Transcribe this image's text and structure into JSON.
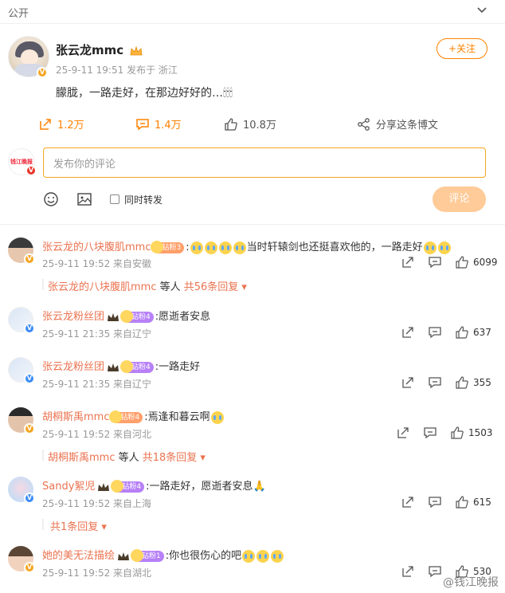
{
  "visibility": {
    "label": "公开"
  },
  "post": {
    "author": "张云龙mmc",
    "time": "25-9-11 19:51",
    "location": "发布于 浙江",
    "follow_label": "+关注",
    "text": "朦胧，一路走好，在那边好好的…🕯🕯🕯",
    "reposts": "1.2万",
    "comments": "1.4万",
    "likes": "10.8万",
    "share_label": "分享这条博文"
  },
  "composer": {
    "placeholder": "发布你的评论",
    "repost_label": "同时转发",
    "submit_label": "评论",
    "self_avatar_text": "钱江晚报"
  },
  "comments": [
    {
      "name": "张云龙的八块腹肌mmc",
      "badge": "钻粉3",
      "text": "当时轩辕剑也还挺喜欢他的，一路走好",
      "time": "25-9-11 19:52 来自安徽",
      "likes": "6099",
      "reply_user": "张云龙的八块腹肌mmc",
      "reply_mid": " 等人 ",
      "reply_count": "共56条回复"
    },
    {
      "name": "张云龙粉丝团",
      "badge": "钻粉4",
      "text": ":愿逝者安息",
      "time": "25-9-11 21:35 来自辽宁",
      "likes": "637"
    },
    {
      "name": "张云龙粉丝团",
      "badge": "钻粉4",
      "text": ":一路走好",
      "time": "25-9-11 21:35 来自辽宁",
      "likes": "355"
    },
    {
      "name": "胡桐斯禹mmc",
      "badge": "钻粉4",
      "text": ":焉逢和暮云啊",
      "time": "25-9-11 19:52 来自河北",
      "likes": "1503",
      "reply_user": "胡桐斯禹mmc",
      "reply_mid": " 等人 ",
      "reply_count": "共18条回复"
    },
    {
      "name": "Sandy絮児",
      "badge": "钻粉4",
      "text": ":一路走好，愿逝者安息🙏",
      "time": "25-9-11 19:52 来自上海",
      "likes": "615",
      "reply_count": "共1条回复"
    },
    {
      "name": "她的美无法描绘",
      "badge": "钻粉1",
      "text": ":你也很伤心的吧",
      "time": "25-9-11 19:52 来自湖北",
      "likes": "530"
    }
  ],
  "watermark": "@钱江晚报"
}
